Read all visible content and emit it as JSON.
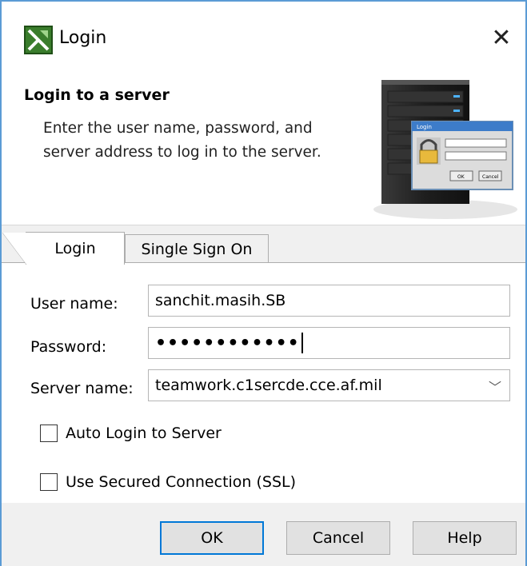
{
  "window": {
    "title": "Login",
    "close_glyph": "✕",
    "accent": "#0078d7"
  },
  "banner": {
    "title": "Login to a server",
    "description": "Enter the user name, password, and server address to log in to the server.",
    "art_login_title": "Login",
    "art_ok_label": "OK",
    "art_cancel_label": "Cancel"
  },
  "tabs": [
    {
      "label": "Login",
      "selected": true
    },
    {
      "label": "Single Sign On",
      "selected": false
    }
  ],
  "form": {
    "username_label": "User name:",
    "username_value": "sanchit.masih.SB",
    "password_label": "Password:",
    "password_value": "••••••••••••",
    "server_label": "Server name:",
    "server_value": "teamwork.c1sercde.cce.af.mil",
    "auto_login_label": "Auto Login to Server",
    "auto_login_checked": false,
    "ssl_label": "Use Secured Connection (SSL)",
    "ssl_checked": false
  },
  "buttons": {
    "ok": "OK",
    "cancel": "Cancel",
    "help": "Help"
  },
  "icons": {
    "app": "magicdraw-app-icon",
    "close": "close-icon",
    "dropdown": "chevron-down-icon"
  }
}
